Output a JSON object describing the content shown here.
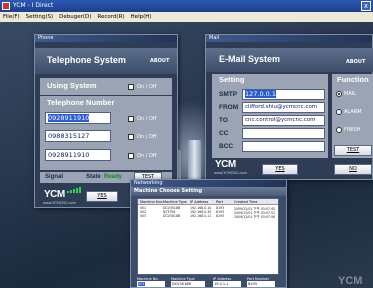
{
  "window": {
    "title": "YCM - I Direct",
    "close": "x"
  },
  "menu": [
    "File(F)",
    "Setting(S)",
    "Debuger(D)",
    "Record(R)",
    "Help(H)"
  ],
  "phone": {
    "caption": "Phone",
    "title": "Telephone System",
    "about": "ABOUT",
    "using_label": "Using System",
    "on_off": "On / Off",
    "number_label": "Telephone Number",
    "numbers": [
      "0928911910",
      "0988315127",
      "0928911910"
    ],
    "signal_label": "Signal",
    "state_label": "State",
    "state_value": "Ready",
    "test_label": "TEST",
    "yes_label": "YES",
    "logo": "YCM",
    "logo_sub": "www.YCMCNC.com"
  },
  "mail": {
    "caption": "Mail",
    "title": "E-Mail System",
    "about": "ABOUT",
    "setting_label": "Setting",
    "function_label": "Function",
    "fields": [
      {
        "label": "SMTP",
        "value": "127.0.0.1"
      },
      {
        "label": "FROM",
        "value": "clifford.shiu@ycmcnc.com"
      },
      {
        "label": "TO",
        "value": "cnc.control@ycmcnc.com"
      },
      {
        "label": "CC",
        "value": ""
      },
      {
        "label": "BCC",
        "value": ""
      }
    ],
    "functions": [
      "MAIL",
      "ALARM",
      "FINISH"
    ],
    "test_label": "TEST",
    "yes_label": "YES",
    "no_label": "NO",
    "logo": "YCM",
    "logo_sub": "www.YCMCNC.com"
  },
  "mcs": {
    "caption": "Networking",
    "title": "Machine Choose Setting",
    "headers": [
      "Machine Kno.",
      "Machine Type",
      "IP Address",
      "Port",
      "Created Time"
    ],
    "rows": [
      [
        "001",
        "DCV3018B",
        "192.168.0.10",
        "8193",
        "2009/12/01 下午 03:07:45"
      ],
      [
        "002",
        "NT3T58",
        "192.168.0.30",
        "8193",
        "2009/12/01 下午 03:07:51"
      ],
      [
        "003",
        "DCV3018B",
        "192.168.0.11",
        "8193",
        "2009/12/01 下午 03:07:56"
      ]
    ],
    "footer_labels": [
      "Machine No.",
      "Machine Type",
      "IP Address",
      "Port Number"
    ],
    "footer_values": [
      "001",
      "DCV3018B",
      "19.2.1.1",
      "8193"
    ]
  },
  "bg_logo": "YCM",
  "colors": {
    "accent": "#2a5bd7",
    "signal": "#2bd84a",
    "panel": "#2e3d55"
  }
}
